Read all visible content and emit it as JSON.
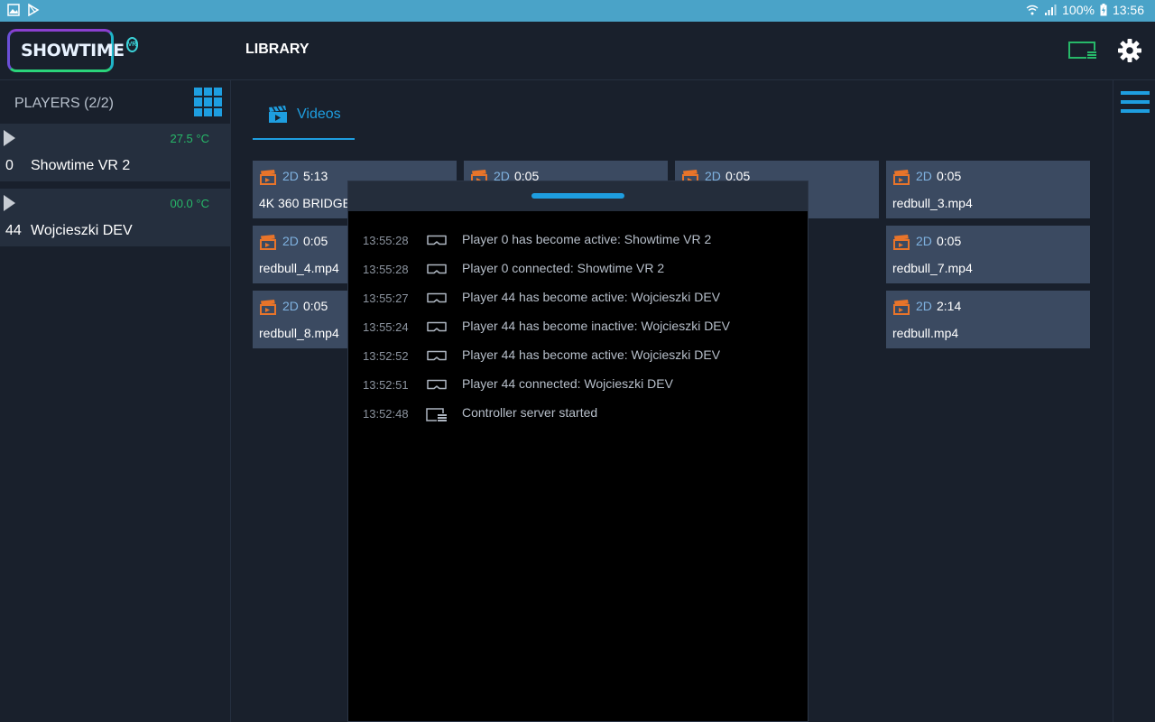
{
  "status_bar": {
    "battery": "100%",
    "time": "13:56"
  },
  "header": {
    "logo_text": "SHOWTIME",
    "logo_badge": "VR",
    "title": "LIBRARY"
  },
  "sidebar": {
    "players_title": "PLAYERS (2/2)",
    "players": [
      {
        "id": "0",
        "name": "Showtime VR 2",
        "temp": "27.5 °C"
      },
      {
        "id": "44",
        "name": "Wojcieszki DEV",
        "temp": "00.0 °C"
      }
    ]
  },
  "tabs": [
    {
      "label": "Videos",
      "icon": "clapperboard-icon"
    }
  ],
  "videos": [
    {
      "format": "2D",
      "duration": "5:13",
      "title": "4K 360 BRIDGE"
    },
    {
      "format": "2D",
      "duration": "0:05",
      "title": ""
    },
    {
      "format": "2D",
      "duration": "0:05",
      "title": ""
    },
    {
      "format": "2D",
      "duration": "0:05",
      "title": "redbull_3.mp4"
    },
    {
      "format": "2D",
      "duration": "0:05",
      "title": "redbull_4.mp4"
    },
    {
      "format": "2D",
      "duration": "0:05",
      "title": "redbull_7.mp4"
    },
    {
      "format": "2D",
      "duration": "0:05",
      "title": "redbull_8.mp4"
    },
    {
      "format": "2D",
      "duration": "2:14",
      "title": "redbull.mp4"
    }
  ],
  "log": [
    {
      "time": "13:55:28",
      "icon": "vr-headset-icon",
      "message": "Player 0 has become active: Showtime VR 2"
    },
    {
      "time": "13:55:28",
      "icon": "vr-headset-icon",
      "message": "Player 0 connected: Showtime VR 2"
    },
    {
      "time": "13:55:27",
      "icon": "vr-headset-icon",
      "message": "Player 44 has become active: Wojcieszki DEV"
    },
    {
      "time": "13:55:24",
      "icon": "vr-headset-icon",
      "message": "Player 44 has become inactive: Wojcieszki DEV"
    },
    {
      "time": "13:52:52",
      "icon": "vr-headset-icon",
      "message": "Player 44 has become active: Wojcieszki DEV"
    },
    {
      "time": "13:52:51",
      "icon": "vr-headset-icon",
      "message": "Player 44 connected: Wojcieszki DEV"
    },
    {
      "time": "13:52:48",
      "icon": "server-icon",
      "message": "Controller server started"
    }
  ],
  "colors": {
    "accent": "#1e9ee0",
    "temp_ok": "#27b869",
    "video_icon": "#e8742a",
    "status_bar": "#4aa3c8"
  }
}
